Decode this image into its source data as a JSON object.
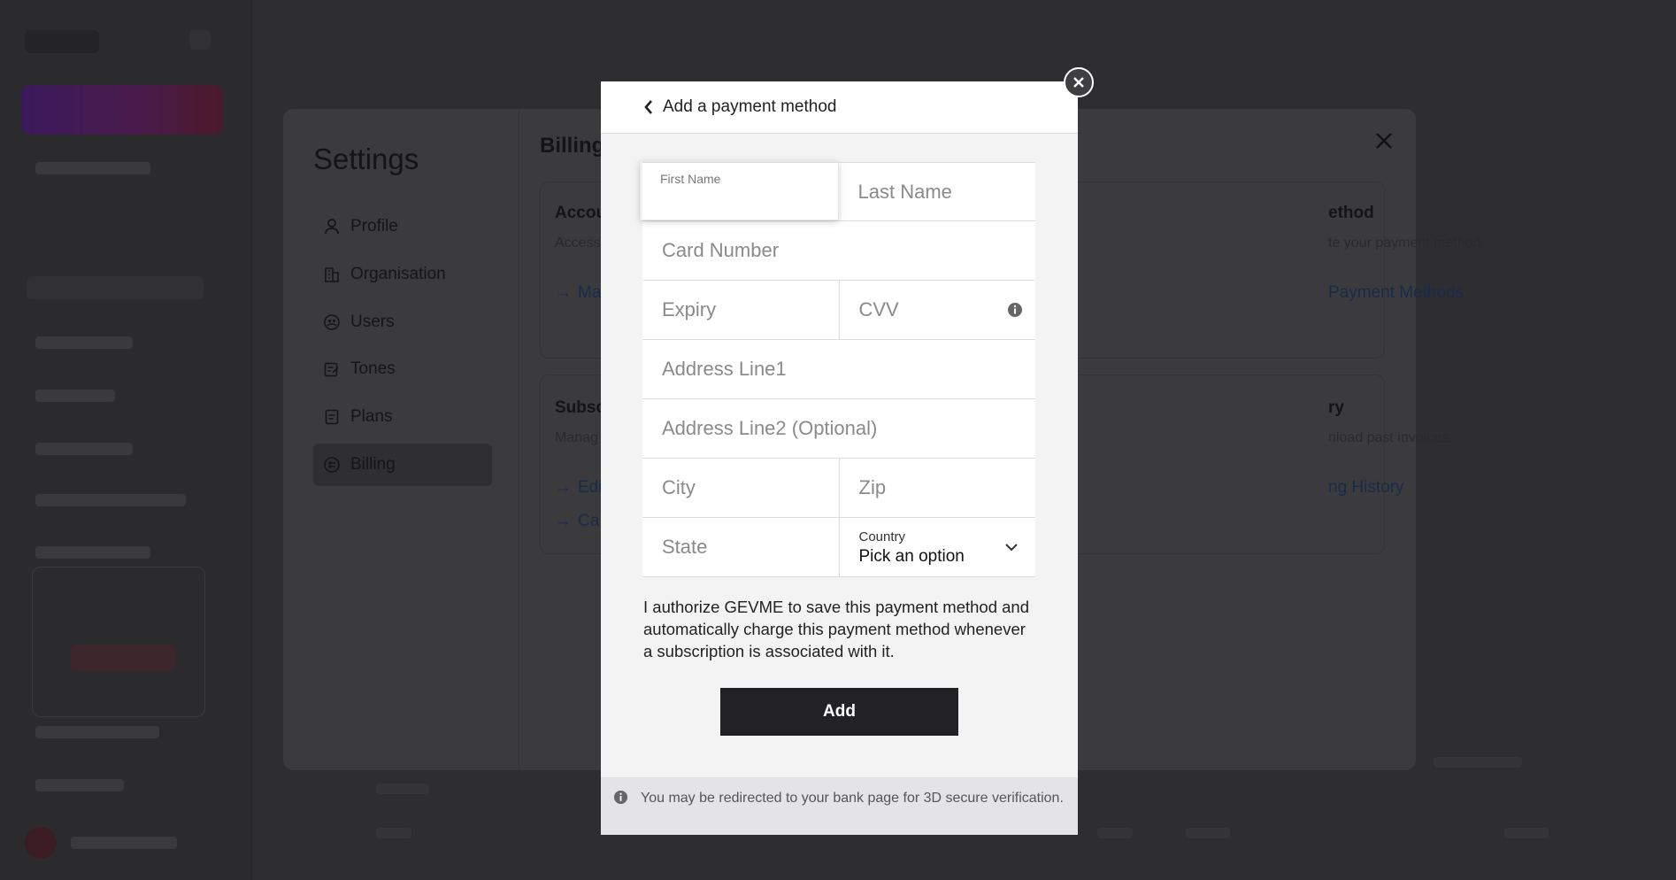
{
  "settings": {
    "title": "Settings",
    "heading": "Billing",
    "nav": [
      {
        "label": "Profile",
        "icon": "user-icon"
      },
      {
        "label": "Organisation",
        "icon": "building-icon"
      },
      {
        "label": "Users",
        "icon": "users-icon"
      },
      {
        "label": "Tones",
        "icon": "edit-note-icon"
      },
      {
        "label": "Plans",
        "icon": "document-icon"
      },
      {
        "label": "Billing",
        "icon": "billing-icon",
        "active": true
      }
    ],
    "cards": {
      "account": {
        "title": "Accou",
        "sub": "Access",
        "link": "Ma"
      },
      "payment_method": {
        "title": "ethod",
        "sub": "te your payment method.",
        "link": "Payment Methods"
      },
      "subscription": {
        "title": "Subsc",
        "sub": "Manag",
        "link1": "Edi",
        "link2": "Ca"
      },
      "history": {
        "title": "ry",
        "sub": "nload past invoices.",
        "link": "ng History"
      }
    }
  },
  "modal": {
    "title": "Add a payment method",
    "fields": {
      "first_name": {
        "label": "First Name",
        "value": ""
      },
      "last_name": {
        "placeholder": "Last Name"
      },
      "card_number": {
        "placeholder": "Card Number"
      },
      "expiry": {
        "placeholder": "Expiry"
      },
      "cvv": {
        "placeholder": "CVV"
      },
      "address1": {
        "placeholder": "Address Line1"
      },
      "address2": {
        "placeholder": "Address Line2 (Optional)"
      },
      "city": {
        "placeholder": "City"
      },
      "zip": {
        "placeholder": "Zip"
      },
      "state": {
        "placeholder": "State"
      },
      "country": {
        "label": "Country",
        "value": "Pick an option"
      }
    },
    "consent": "I authorize GEVME to save this payment method and automatically charge this payment method whenever a subscription is associated with it.",
    "submit_label": "Add",
    "note": "You may be redirected to your bank page for 3D secure verification."
  },
  "colors": {
    "overlay": "#2e2e30",
    "modal_bg": "#f3f3f4",
    "button_bg": "#222224",
    "link_blue": "#1a2a4a"
  }
}
